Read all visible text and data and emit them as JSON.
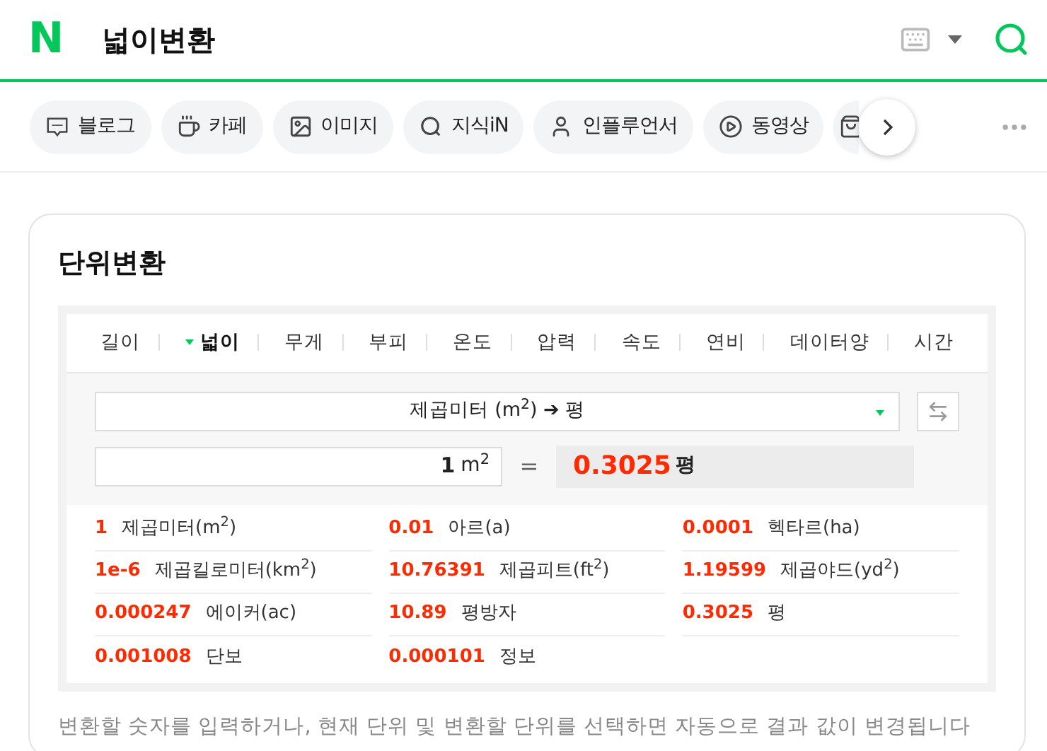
{
  "header": {
    "logo": "N",
    "query": "넓이변환"
  },
  "chips": [
    {
      "kind": "blog",
      "label": "블로그"
    },
    {
      "kind": "cup",
      "label": "카페"
    },
    {
      "kind": "image",
      "label": "이미지"
    },
    {
      "kind": "q",
      "label": "지식iN"
    },
    {
      "kind": "person",
      "label": "인플루언서"
    },
    {
      "kind": "play",
      "label": "동영상"
    },
    {
      "kind": "bag"
    }
  ],
  "card": {
    "title": "단위변환",
    "tabs": [
      {
        "label": "길이",
        "selected": false
      },
      {
        "label": "넓이",
        "selected": true
      },
      {
        "label": "무게",
        "selected": false
      },
      {
        "label": "부피",
        "selected": false
      },
      {
        "label": "온도",
        "selected": false
      },
      {
        "label": "압력",
        "selected": false
      },
      {
        "label": "속도",
        "selected": false
      },
      {
        "label": "연비",
        "selected": false
      },
      {
        "label": "데이터양",
        "selected": false
      },
      {
        "label": "시간",
        "selected": false
      }
    ],
    "select": "제곱미터 (m$^{2}$) ➔ 평",
    "input": {
      "value": "1",
      "unit": "m$^{2}$"
    },
    "equals": "=",
    "result": {
      "value": "0.3025",
      "unit": "평"
    },
    "rows": [
      {
        "value": "1",
        "unit": "제곱미터(m$^{2}$)"
      },
      {
        "value": "0.01",
        "unit": "아르(a)"
      },
      {
        "value": "0.0001",
        "unit": "헥타르(ha)"
      },
      {
        "value": "1e-6",
        "unit": "제곱킬로미터(km$^{2}$)"
      },
      {
        "value": "10.76391",
        "unit": "제곱피트(ft$^{2}$)"
      },
      {
        "value": "1.19599",
        "unit": "제곱야드(yd$^{2}$)"
      },
      {
        "value": "0.000247",
        "unit": "에이커(ac)"
      },
      {
        "value": "10.89",
        "unit": "평방자"
      },
      {
        "value": "0.3025",
        "unit": "평"
      },
      {
        "value": "0.001008",
        "unit": "단보"
      },
      {
        "value": "0.000101",
        "unit": "정보"
      }
    ],
    "note": "변환할 숫자를 입력하거나, 현재 단위 및 변환할 단위를 선택하면 자동으로 결과 값이 변경됩니다"
  }
}
